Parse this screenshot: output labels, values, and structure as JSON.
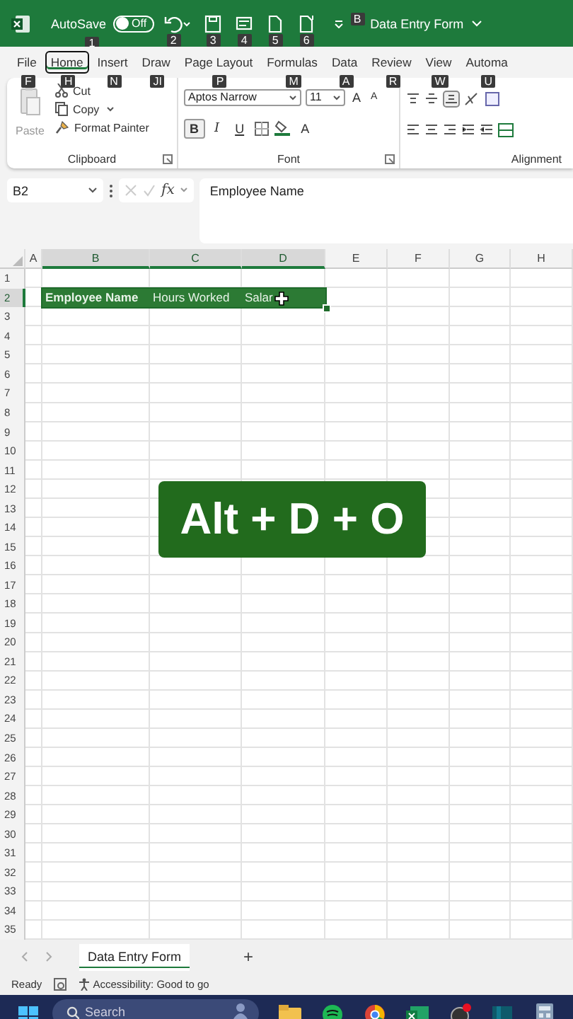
{
  "title_bar": {
    "autosave_label": "AutoSave",
    "autosave_keytip": "1",
    "toggle": {
      "on": false,
      "label": "Off"
    },
    "quick_access": [
      {
        "kind": "undo",
        "keytip": "2"
      },
      {
        "kind": "save",
        "keytip": "3"
      },
      {
        "kind": "form",
        "keytip": "4"
      },
      {
        "kind": "doc",
        "keytip": "5"
      },
      {
        "kind": "doc-new",
        "keytip": "6"
      }
    ],
    "customize_keytip": "B",
    "title": "Data Entry Form"
  },
  "ribbon_tabs": [
    {
      "label": "File",
      "keytip": "F",
      "selected": false
    },
    {
      "label": "Home",
      "keytip": "H",
      "selected": true
    },
    {
      "label": "Insert",
      "keytip": "N",
      "selected": false
    },
    {
      "label": "Draw",
      "keytip": "JI",
      "selected": false
    },
    {
      "label": "Page Layout",
      "keytip": "P",
      "selected": false
    },
    {
      "label": "Formulas",
      "keytip": "M",
      "selected": false
    },
    {
      "label": "Data",
      "keytip": "A",
      "selected": false
    },
    {
      "label": "Review",
      "keytip": "R",
      "selected": false
    },
    {
      "label": "View",
      "keytip": "W",
      "selected": false
    },
    {
      "label": "Automa",
      "keytip": "U",
      "selected": false
    }
  ],
  "clipboard_group": {
    "paste": "Paste",
    "cut": "Cut",
    "copy": "Copy",
    "format_painter": "Format Painter",
    "label": "Clipboard"
  },
  "font_group": {
    "font": "Aptos Narrow",
    "size": "11",
    "grow": "A",
    "shrink": "A",
    "bold": {
      "label": "B",
      "selected": true
    },
    "italic": "I",
    "underline": "U",
    "font_color": "A",
    "label": "Font"
  },
  "alignment_group": {
    "label": "Alignment"
  },
  "formula_bar": {
    "name_box": "B2",
    "function_label": "fx",
    "value": "Employee Name"
  },
  "columns": [
    {
      "label": "A",
      "selected": false
    },
    {
      "label": "B",
      "selected": true
    },
    {
      "label": "C",
      "selected": true
    },
    {
      "label": "D",
      "selected": true
    },
    {
      "label": "E",
      "selected": false
    },
    {
      "label": "F",
      "selected": false
    },
    {
      "label": "G",
      "selected": false
    },
    {
      "label": "H",
      "selected": false
    }
  ],
  "rows": [
    {
      "header": "1",
      "selected": false
    },
    {
      "header": "2",
      "selected": true,
      "cells": [
        {
          "kind": "blank"
        },
        {
          "kind": "text",
          "text": "Employee Name",
          "bold": true
        },
        {
          "kind": "text",
          "text": "Hours Worked",
          "bold": false
        },
        {
          "kind": "text",
          "text": "Salar",
          "bold": false
        }
      ]
    },
    {
      "header": "3",
      "selected": false
    },
    {
      "header": "4",
      "selected": false
    },
    {
      "header": "5",
      "selected": false
    },
    {
      "header": "6",
      "selected": false
    },
    {
      "header": "7",
      "selected": false
    },
    {
      "header": "8",
      "selected": false
    },
    {
      "header": "9",
      "selected": false
    },
    {
      "header": "10",
      "selected": false
    },
    {
      "header": "11",
      "selected": false
    },
    {
      "header": "12",
      "selected": false
    },
    {
      "header": "13",
      "selected": false
    },
    {
      "header": "14",
      "selected": false
    },
    {
      "header": "15",
      "selected": false
    },
    {
      "header": "16",
      "selected": false
    },
    {
      "header": "17",
      "selected": false
    },
    {
      "header": "18",
      "selected": false
    },
    {
      "header": "19",
      "selected": false
    },
    {
      "header": "20",
      "selected": false
    },
    {
      "header": "21",
      "selected": false
    },
    {
      "header": "22",
      "selected": false
    },
    {
      "header": "23",
      "selected": false
    },
    {
      "header": "24",
      "selected": false
    },
    {
      "header": "25",
      "selected": false
    },
    {
      "header": "26",
      "selected": false
    },
    {
      "header": "27",
      "selected": false
    },
    {
      "header": "28",
      "selected": false
    },
    {
      "header": "29",
      "selected": false
    },
    {
      "header": "30",
      "selected": false
    },
    {
      "header": "31",
      "selected": false
    },
    {
      "header": "32",
      "selected": false
    },
    {
      "header": "33",
      "selected": false
    },
    {
      "header": "34",
      "selected": false
    },
    {
      "header": "35",
      "selected": false
    }
  ],
  "overlay": {
    "text": "Alt + D + O"
  },
  "sheet_tabs": [
    {
      "label": "Data Entry Form",
      "selected": true
    }
  ],
  "add_sheet": "+",
  "status_bar": {
    "mode": "Ready",
    "accessibility": "Accessibility: Good to go"
  },
  "taskbar": {
    "search_placeholder": "Search"
  }
}
